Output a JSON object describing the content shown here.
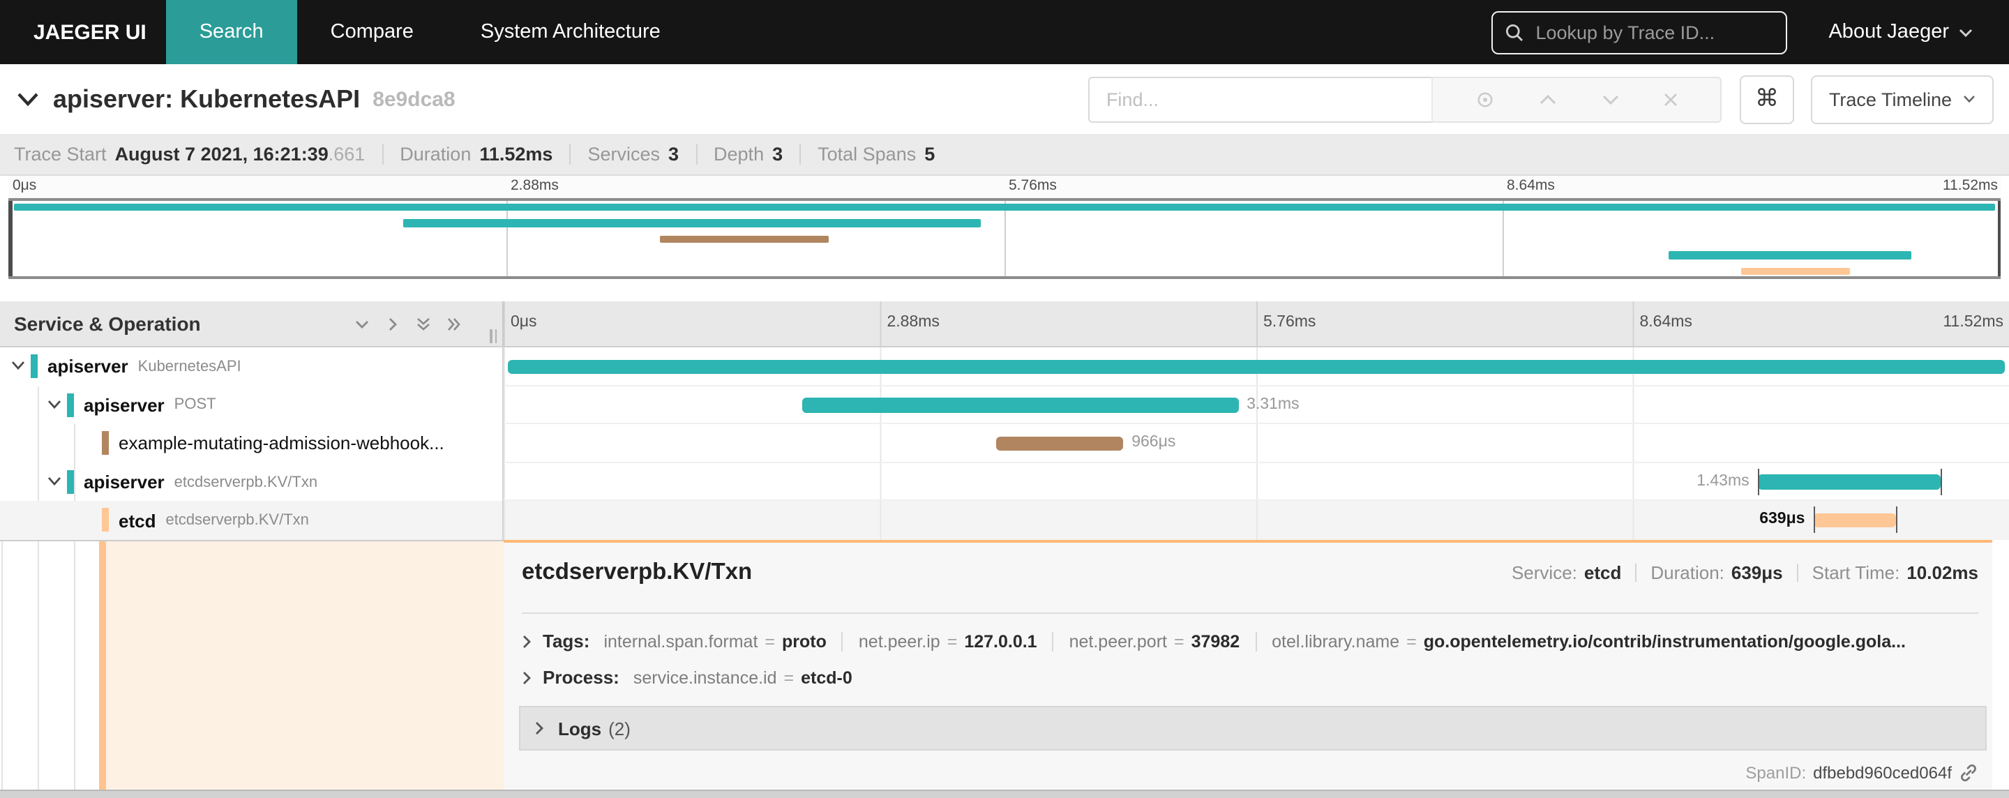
{
  "nav": {
    "brand": "JAEGER UI",
    "tabs": [
      {
        "label": "Search",
        "active": true
      },
      {
        "label": "Compare",
        "active": false
      },
      {
        "label": "System Architecture",
        "active": false
      }
    ],
    "lookup_placeholder": "Lookup by Trace ID...",
    "about_label": "About Jaeger",
    "active_tab_color": "#2b9c98"
  },
  "header": {
    "title": "apiserver: KubernetesAPI",
    "trace_id": "8e9dca8",
    "find_placeholder": "Find...",
    "shortcut_glyph": "⌘",
    "view_label": "Trace Timeline"
  },
  "summary": {
    "items": [
      {
        "label": "Trace Start",
        "value": "August 7 2021, 16:21:39",
        "suffix": ".661"
      },
      {
        "label": "Duration",
        "value": "11.52ms"
      },
      {
        "label": "Services",
        "value": "3"
      },
      {
        "label": "Depth",
        "value": "3"
      },
      {
        "label": "Total Spans",
        "value": "5"
      }
    ]
  },
  "ticks": [
    "0μs",
    "2.88ms",
    "5.76ms",
    "8.64ms",
    "11.52ms"
  ],
  "panel": {
    "title": "Service & Operation"
  },
  "colors": {
    "teal": "#2cb5b2",
    "brown": "#b0855f",
    "peach": "#ffc795"
  },
  "spans": [
    {
      "service": "apiserver",
      "operation": "KubernetesAPI",
      "depth": 0,
      "color": "teal",
      "bar": {
        "left": 0.3,
        "width": 99.4,
        "label": "",
        "label_side": "right",
        "marks": false
      },
      "selected": false
    },
    {
      "service": "apiserver",
      "operation": "POST",
      "depth": 1,
      "color": "teal",
      "bar": {
        "left": 19.8,
        "width": 29.0,
        "label": "3.31ms",
        "label_side": "right",
        "marks": false
      },
      "selected": false
    },
    {
      "service": "example-mutating-admission-webhook...",
      "operation": "",
      "depth": 2,
      "color": "brown",
      "bar": {
        "left": 32.7,
        "width": 8.46,
        "label": "966μs",
        "label_side": "right",
        "marks": false
      },
      "selected": false
    },
    {
      "service": "apiserver",
      "operation": "etcdserverpb.KV/Txn",
      "depth": 1,
      "color": "teal",
      "bar": {
        "left": 83.3,
        "width": 12.2,
        "label": "1.43ms",
        "label_side": "left",
        "marks": true
      },
      "selected": false
    },
    {
      "service": "etcd",
      "operation": "etcdserverpb.KV/Txn",
      "depth": 2,
      "color": "peach",
      "bar": {
        "left": 87.0,
        "width": 5.45,
        "label": "639μs",
        "label_side": "left",
        "marks": true
      },
      "selected": true
    }
  ],
  "detail": {
    "title": "etcdserverpb.KV/Txn",
    "meta": [
      {
        "label": "Service:",
        "value": "etcd"
      },
      {
        "label": "Duration:",
        "value": "639μs"
      },
      {
        "label": "Start Time:",
        "value": "10.02ms"
      }
    ],
    "tags_header": "Tags:",
    "tags": [
      {
        "key": "internal.span.format",
        "value": "proto"
      },
      {
        "key": "net.peer.ip",
        "value": "127.0.0.1"
      },
      {
        "key": "net.peer.port",
        "value": "37982"
      },
      {
        "key": "otel.library.name",
        "value": "go.opentelemetry.io/contrib/instrumentation/google.gola..."
      }
    ],
    "process_header": "Process:",
    "process": {
      "key": "service.instance.id",
      "value": "etcd-0"
    },
    "logs_label": "Logs",
    "logs_count": "(2)",
    "spanid_label": "SpanID:",
    "spanid_value": "dfbebd960ced064f"
  }
}
